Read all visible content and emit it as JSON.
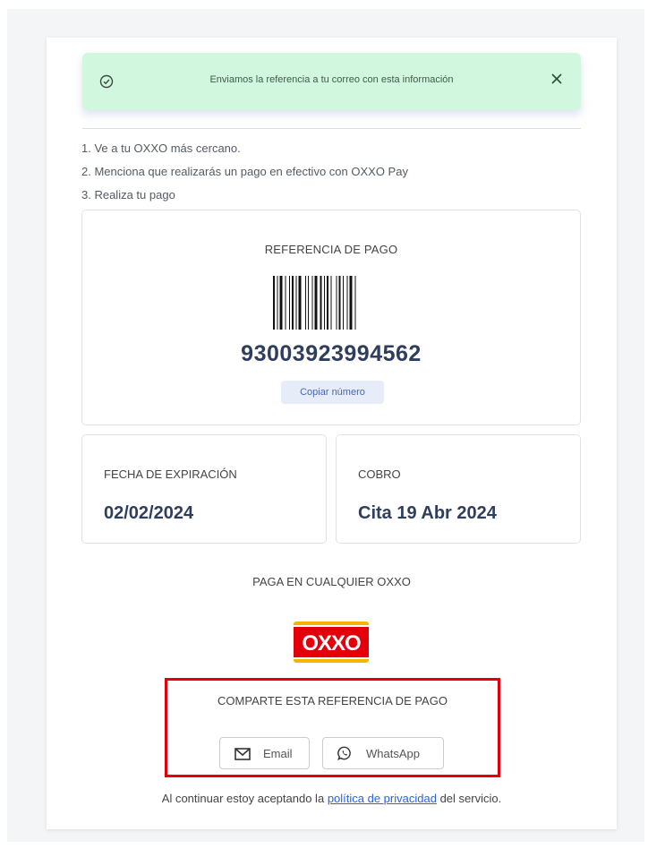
{
  "alert": {
    "message": "Enviamos la referencia a tu correo con esta información",
    "icon": "check-circle-icon",
    "close_icon": "close-icon",
    "bg_color": "#d1f7de"
  },
  "steps": [
    "1. Ve a tu OXXO más cercano.",
    "2. Menciona que realizarás un pago en efectivo con OXXO Pay",
    "3. Realiza tu pago"
  ],
  "reference": {
    "title": "REFERENCIA DE PAGO",
    "number": "93003923994562",
    "copy_label": "Copiar número"
  },
  "expiration": {
    "label": "FECHA DE EXPIRACIÓN",
    "value": "02/02/2024"
  },
  "charge": {
    "label": "COBRO",
    "value": "Cita 19 Abr 2024"
  },
  "pay_anywhere": "PAGA EN CUALQUIER OXXO",
  "logo": {
    "text": "OXXO",
    "red": "#e3000b",
    "yellow": "#f5b400"
  },
  "share": {
    "title": "COMPARTE ESTA REFERENCIA DE PAGO",
    "email_label": "Email",
    "whatsapp_label": "WhatsApp",
    "highlight_color": "#e3000b"
  },
  "consent": {
    "before": "Al continuar estoy aceptando la",
    "link": "política de privacidad",
    "after": "del servicio."
  }
}
